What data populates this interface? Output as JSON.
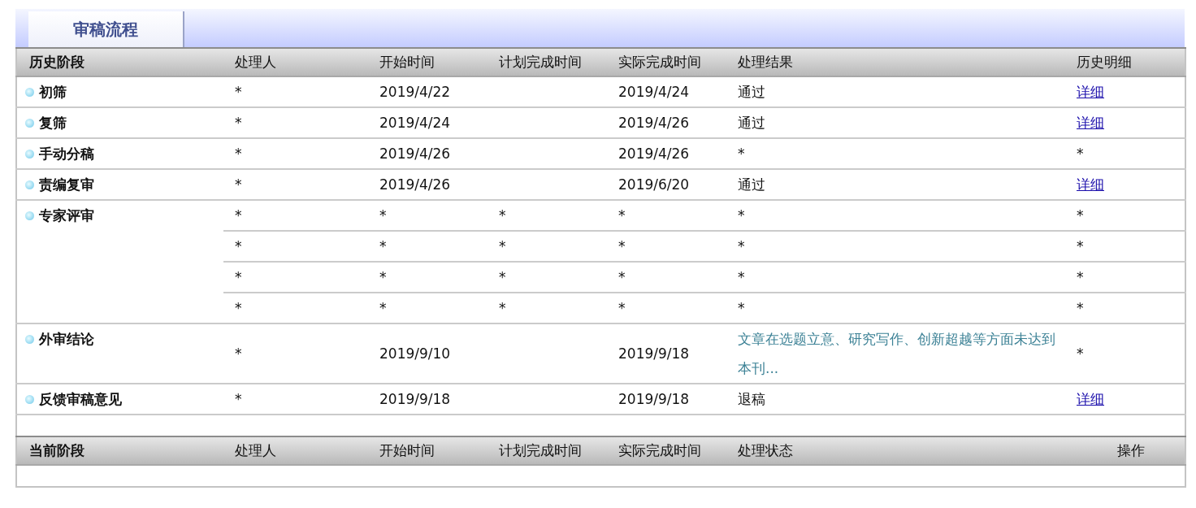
{
  "tab": {
    "label": "审稿流程",
    "selected": true
  },
  "history": {
    "columns": [
      "历史阶段",
      "处理人",
      "开始时间",
      "计划完成时间",
      "实际完成时间",
      "处理结果",
      "历史明细"
    ],
    "stages": [
      {
        "name": "初筛",
        "records": [
          {
            "handler": "*",
            "start": "2019/4/22",
            "actual": "2019/4/24",
            "result": {
              "kind": "plain",
              "text": "通过"
            },
            "detail": {
              "kind": "link",
              "text": "详细"
            }
          }
        ]
      },
      {
        "name": "复筛",
        "records": [
          {
            "handler": "*",
            "start": "2019/4/24",
            "actual": "2019/4/26",
            "result": {
              "kind": "plain",
              "text": "通过"
            },
            "detail": {
              "kind": "link",
              "text": "详细"
            }
          }
        ]
      },
      {
        "name": "手动分稿",
        "records": [
          {
            "handler": "*",
            "start": "2019/4/26",
            "actual": "2019/4/26",
            "result": {
              "kind": "plain",
              "text": "*"
            },
            "detail": {
              "kind": "plain",
              "text": "*"
            }
          }
        ]
      },
      {
        "name": "责编复审",
        "records": [
          {
            "handler": "*",
            "start": "2019/4/26",
            "actual": "2019/6/20",
            "result": {
              "kind": "plain",
              "text": "通过"
            },
            "detail": {
              "kind": "link",
              "text": "详细"
            }
          }
        ]
      },
      {
        "name": "专家评审",
        "records": [
          {
            "handler": "*",
            "start": "*",
            "planned": "*",
            "actual": "*",
            "result": {
              "kind": "plain",
              "text": "*"
            },
            "detail": {
              "kind": "plain",
              "text": "*"
            }
          },
          {
            "handler": "*",
            "start": "*",
            "planned": "*",
            "actual": "*",
            "result": {
              "kind": "plain",
              "text": "*"
            },
            "detail": {
              "kind": "plain",
              "text": "*"
            }
          },
          {
            "handler": "*",
            "start": "*",
            "planned": "*",
            "actual": "*",
            "result": {
              "kind": "plain",
              "text": "*"
            },
            "detail": {
              "kind": "plain",
              "text": "*"
            }
          },
          {
            "handler": "*",
            "start": "*",
            "planned": "*",
            "actual": "*",
            "result": {
              "kind": "plain",
              "text": "*"
            },
            "detail": {
              "kind": "plain",
              "text": "*"
            }
          }
        ]
      },
      {
        "name": "外审结论",
        "records": [
          {
            "handler": "*",
            "start": "2019/9/10",
            "actual": "2019/9/18",
            "result": {
              "kind": "summary",
              "text": "文章在选题立意、研究写作、创新超越等方面未达到本刊..."
            },
            "detail": {
              "kind": "plain",
              "text": "*"
            }
          }
        ]
      },
      {
        "name": "反馈审稿意见",
        "records": [
          {
            "handler": "*",
            "start": "2019/9/18",
            "actual": "2019/9/18",
            "result": {
              "kind": "plain",
              "text": "退稿"
            },
            "detail": {
              "kind": "link",
              "text": "详细"
            }
          }
        ]
      }
    ]
  },
  "current": {
    "columns": [
      "当前阶段",
      "处理人",
      "开始时间",
      "计划完成时间",
      "实际完成时间",
      "处理状态",
      "操作"
    ]
  }
}
